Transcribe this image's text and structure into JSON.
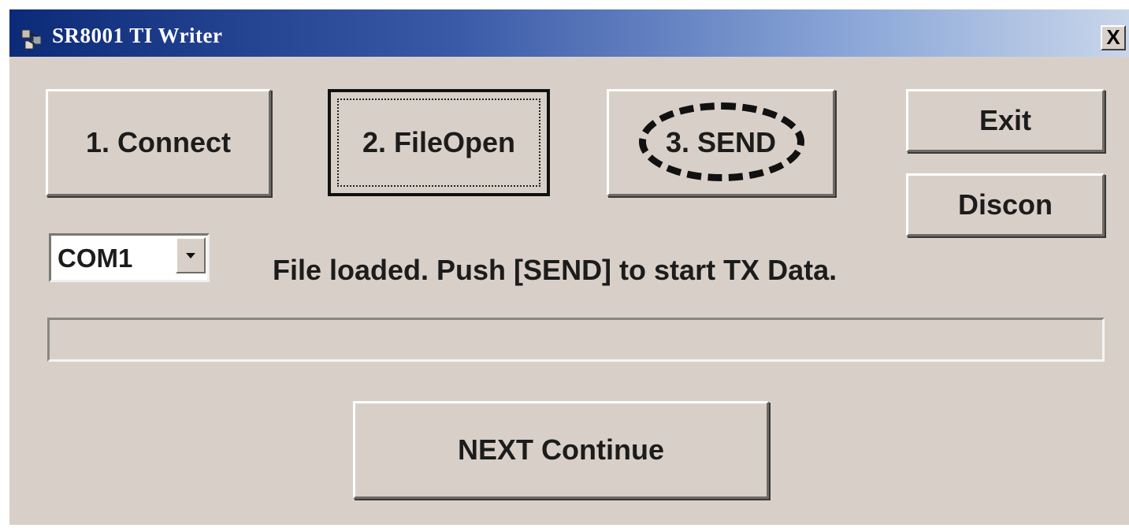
{
  "window": {
    "title": "SR8001 TI Writer",
    "close_label": "X"
  },
  "buttons": {
    "connect": "1. Connect",
    "file_open": "2. FileOpen",
    "send": "3. SEND",
    "exit": "Exit",
    "discon": "Discon",
    "next": "NEXT Continue"
  },
  "port_select": {
    "value": "COM1"
  },
  "status_text": "File loaded. Push [SEND] to start TX Data.",
  "progress": {
    "value": 0
  },
  "icons": {
    "app": "app-icon",
    "dropdown": "chevron-down-icon"
  }
}
